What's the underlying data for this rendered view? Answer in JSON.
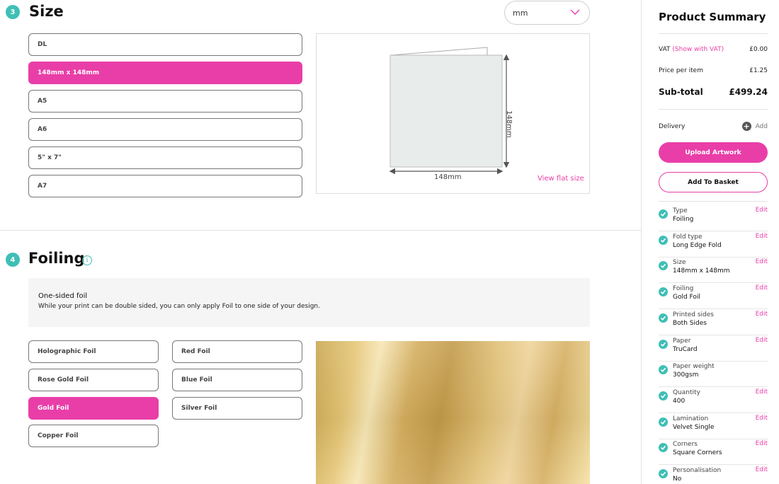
{
  "size_section": {
    "step": "3",
    "title": "Size",
    "unit": "mm",
    "options": [
      "DL",
      "148mm x 148mm",
      "A5",
      "A6",
      "5\" x 7\"",
      "A7"
    ],
    "selected_index": 1,
    "preview": {
      "width_label": "148mm",
      "height_label": "148mm",
      "view_flat_label": "View flat size"
    }
  },
  "foiling_section": {
    "step": "4",
    "title": "Foiling",
    "info_icon": "info-icon",
    "note_title": "One-sided foil",
    "note_text": "While your print can be double sided, you can only apply Foil to one side of your design.",
    "options_left": [
      "Holographic Foil",
      "Rose Gold Foil",
      "Gold Foil",
      "Copper Foil"
    ],
    "options_right": [
      "Red Foil",
      "Blue Foil",
      "Silver Foil"
    ],
    "selected": "Gold Foil"
  },
  "summary": {
    "title": "Product Summary",
    "vat_label": "VAT",
    "vat_link": "(Show with VAT)",
    "vat_value": "£0.00",
    "price_label": "Price per item",
    "price_value": "£1.25",
    "subtotal_label": "Sub-total",
    "subtotal_value": "£499.24",
    "delivery_label": "Delivery",
    "delivery_action": "Add",
    "upload_label": "Upload Artwork",
    "basket_label": "Add To Basket",
    "items": [
      {
        "label": "Type",
        "value": "Foiling",
        "edit": "Edit"
      },
      {
        "label": "Fold type",
        "value": "Long Edge Fold",
        "edit": "Edit"
      },
      {
        "label": "Size",
        "value": "148mm x 148mm",
        "edit": "Edit"
      },
      {
        "label": "Foiling",
        "value": "Gold Foil",
        "edit": "Edit"
      },
      {
        "label": "Printed sides",
        "value": "Both Sides",
        "edit": "Edit"
      },
      {
        "label": "Paper",
        "value": "TruCard",
        "edit": "Edit"
      },
      {
        "label": "Paper weight",
        "value": "300gsm",
        "edit": ""
      },
      {
        "label": "Quantity",
        "value": "400",
        "edit": "Edit"
      },
      {
        "label": "Lamination",
        "value": "Velvet Single",
        "edit": "Edit"
      },
      {
        "label": "Corners",
        "value": "Square Corners",
        "edit": "Edit"
      },
      {
        "label": "Personalisation",
        "value": "No",
        "edit": "Edit"
      }
    ]
  },
  "colors": {
    "accent": "#e93ea8",
    "step_badge": "#3fbfb6"
  }
}
